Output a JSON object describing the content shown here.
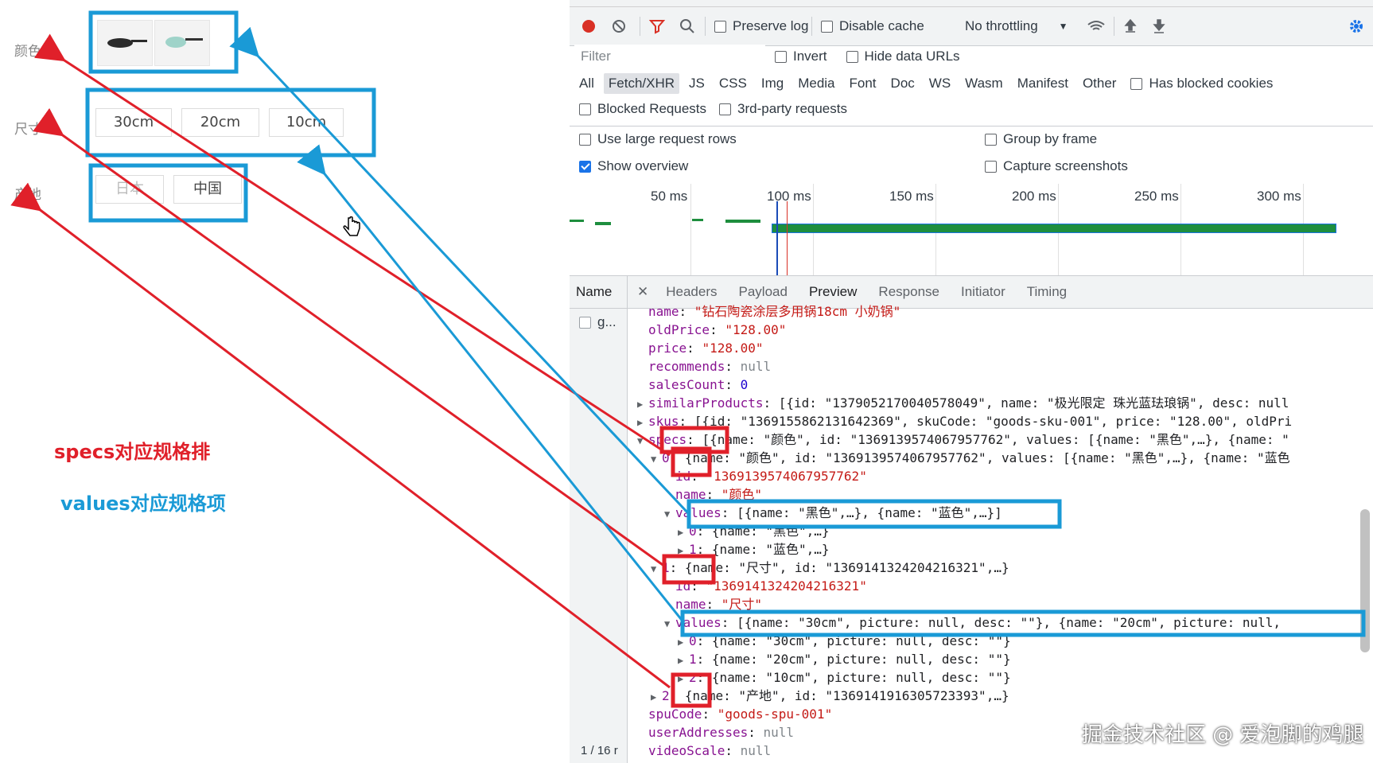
{
  "left": {
    "spec_labels": [
      "颜色",
      "尺寸",
      "产地"
    ],
    "size_options": [
      "30cm",
      "20cm",
      "10cm"
    ],
    "origin_options": [
      "日本",
      "中国"
    ],
    "annotation_specs": "specs对应规格排",
    "annotation_values": "values对应规格项"
  },
  "toolbar": {
    "preserve_log": "Preserve log",
    "disable_cache": "Disable cache",
    "throttling": "No throttling"
  },
  "filter": {
    "placeholder": "Filter",
    "invert": "Invert",
    "hide_data_urls": "Hide data URLs"
  },
  "types": [
    "All",
    "Fetch/XHR",
    "JS",
    "CSS",
    "Img",
    "Media",
    "Font",
    "Doc",
    "WS",
    "Wasm",
    "Manifest",
    "Other"
  ],
  "has_blocked_cookies": "Has blocked cookies",
  "blocked_requests": "Blocked Requests",
  "third_party": "3rd-party requests",
  "settings": {
    "large_rows": "Use large request rows",
    "group_by_frame": "Group by frame",
    "show_overview": "Show overview",
    "capture_screenshots": "Capture screenshots"
  },
  "timeline_ticks": [
    "50 ms",
    "100 ms",
    "150 ms",
    "200 ms",
    "250 ms",
    "300 ms"
  ],
  "name_column": {
    "header": "Name",
    "request": "g...",
    "footer": "1 / 16 r"
  },
  "detail_tabs": [
    "Headers",
    "Payload",
    "Preview",
    "Response",
    "Initiator",
    "Timing"
  ],
  "code_lines": [
    {
      "indent": 0,
      "toggle": "",
      "key": "name",
      "value": "\"钻石陶瓷涂层多用锅18cm 小奶锅\"",
      "type": "s"
    },
    {
      "indent": 0,
      "toggle": "",
      "key": "oldPrice",
      "value": "\"128.00\"",
      "type": "s"
    },
    {
      "indent": 0,
      "toggle": "",
      "key": "price",
      "value": "\"128.00\"",
      "type": "s"
    },
    {
      "indent": 0,
      "toggle": "",
      "key": "recommends",
      "value": "null",
      "type": "g"
    },
    {
      "indent": 0,
      "toggle": "",
      "key": "salesCount",
      "value": "0",
      "type": "n"
    },
    {
      "indent": 0,
      "toggle": "▶",
      "key": "similarProducts",
      "value": "[{id: \"1379052170040578049\", name: \"极光限定 珠光蓝珐琅锅\", desc: null",
      "type": "p"
    },
    {
      "indent": 0,
      "toggle": "▶",
      "key": "skus",
      "value": "[{id: \"1369155862131642369\", skuCode: \"goods-sku-001\", price: \"128.00\", oldPri",
      "type": "p"
    },
    {
      "indent": 0,
      "toggle": "▼",
      "key": "specs",
      "value": "[{name: \"颜色\", id: \"1369139574067957762\", values: [{name: \"黑色\",…}, {name: \"",
      "type": "p"
    },
    {
      "indent": 1,
      "toggle": "▼",
      "key": "0",
      "value": "{name: \"颜色\", id: \"1369139574067957762\", values: [{name: \"黑色\",…}, {name: \"蓝色",
      "type": "p"
    },
    {
      "indent": 2,
      "toggle": "",
      "key": "id",
      "value": "\"1369139574067957762\"",
      "type": "s"
    },
    {
      "indent": 2,
      "toggle": "",
      "key": "name",
      "value": "\"颜色\"",
      "type": "s"
    },
    {
      "indent": 2,
      "toggle": "▼",
      "key": "values",
      "value": "[{name: \"黑色\",…}, {name: \"蓝色\",…}]",
      "type": "p"
    },
    {
      "indent": 3,
      "toggle": "▶",
      "key": "0",
      "value": "{name: \"黑色\",…}",
      "type": "p"
    },
    {
      "indent": 3,
      "toggle": "▶",
      "key": "1",
      "value": "{name: \"蓝色\",…}",
      "type": "p"
    },
    {
      "indent": 1,
      "toggle": "▼",
      "key": "1",
      "value": "{name: \"尺寸\", id: \"1369141324204216321\",…}",
      "type": "p"
    },
    {
      "indent": 2,
      "toggle": "",
      "key": "id",
      "value": "\"1369141324204216321\"",
      "type": "s"
    },
    {
      "indent": 2,
      "toggle": "",
      "key": "name",
      "value": "\"尺寸\"",
      "type": "s"
    },
    {
      "indent": 2,
      "toggle": "▼",
      "key": "values",
      "value": "[{name: \"30cm\", picture: null, desc: \"\"}, {name: \"20cm\", picture: null,",
      "type": "p"
    },
    {
      "indent": 3,
      "toggle": "▶",
      "key": "0",
      "value": "{name: \"30cm\", picture: null, desc: \"\"}",
      "type": "p"
    },
    {
      "indent": 3,
      "toggle": "▶",
      "key": "1",
      "value": "{name: \"20cm\", picture: null, desc: \"\"}",
      "type": "p"
    },
    {
      "indent": 3,
      "toggle": "▶",
      "key": "2",
      "value": "{name: \"10cm\", picture: null, desc: \"\"}",
      "type": "p"
    },
    {
      "indent": 1,
      "toggle": "▶",
      "key": "2",
      "value": "{name: \"产地\", id: \"1369141916305723393\",…}",
      "type": "p"
    },
    {
      "indent": 0,
      "toggle": "",
      "key": "spuCode",
      "value": "\"goods-spu-001\"",
      "type": "s"
    },
    {
      "indent": 0,
      "toggle": "",
      "key": "userAddresses",
      "value": "null",
      "type": "g"
    },
    {
      "indent": 0,
      "toggle": "",
      "key": "videoScale",
      "value": "null",
      "type": "g"
    }
  ],
  "watermark": "掘金技术社区 @ 爱泡脚的鸡腿",
  "colors": {
    "annotation_red": "#e0202a",
    "annotation_blue": "#1a9ad6",
    "record_red": "#d93025",
    "devtools_blue": "#1a73e8"
  }
}
